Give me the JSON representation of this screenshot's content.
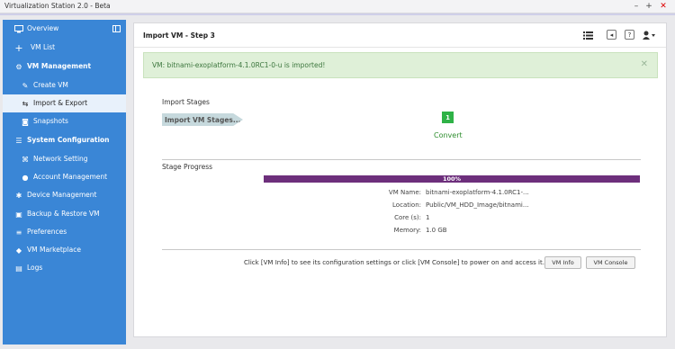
{
  "window": {
    "title": "Virtualization Station 2.0 - Beta",
    "minimize": "–",
    "maximize": "+",
    "close": "✕"
  },
  "sidebar": {
    "items": [
      {
        "label": "Overview",
        "icon": "monitor-icon"
      },
      {
        "label": "VM List",
        "icon": "plus-icon"
      },
      {
        "label": "VM Management",
        "icon": "gears-icon"
      },
      {
        "label": "Create VM",
        "icon": "wrench-icon"
      },
      {
        "label": "Import & Export",
        "icon": "import-export-icon"
      },
      {
        "label": "Snapshots",
        "icon": "camera-icon"
      },
      {
        "label": "System Configuration",
        "icon": "config-icon"
      },
      {
        "label": "Network Setting",
        "icon": "network-icon"
      },
      {
        "label": "Account Management",
        "icon": "account-icon"
      },
      {
        "label": "Device Management",
        "icon": "device-icon"
      },
      {
        "label": "Backup & Restore VM",
        "icon": "backup-icon"
      },
      {
        "label": "Preferences",
        "icon": "preferences-icon"
      },
      {
        "label": "VM Marketplace",
        "icon": "marketplace-icon"
      },
      {
        "label": "Logs",
        "icon": "logs-icon"
      }
    ]
  },
  "panel": {
    "title": "Import VM - Step 3",
    "alert": "VM: bitnami-exoplatform-4.1.0RC1-0-u is imported!",
    "import_stages_label": "Import Stages",
    "stage_arrow": "Import VM Stages...",
    "stage_number": "1",
    "stage_name": "Convert",
    "stage_progress_label": "Stage Progress",
    "progress_value": "100%",
    "details": [
      {
        "key": "VM Name:",
        "value": "bitnami-exoplatform-4.1.0RC1-..."
      },
      {
        "key": "Location:",
        "value": "Public/VM_HDD_Image/bitnami..."
      },
      {
        "key": "Core (s):",
        "value": "1"
      },
      {
        "key": "Memory:",
        "value": "1.0 GB"
      }
    ],
    "footer_text": "Click [VM Info] to see its configuration settings or click [VM Console] to power on and access it.",
    "vm_info_button": "VM Info",
    "vm_console_button": "VM Console"
  }
}
